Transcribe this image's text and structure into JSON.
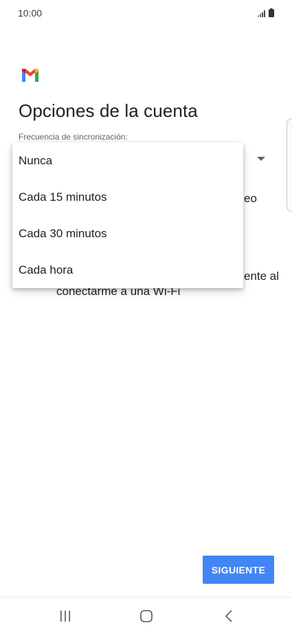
{
  "status_bar": {
    "time": "10:00",
    "icons": [
      "signal-icon",
      "battery-icon"
    ]
  },
  "app": {
    "logo": "gmail-logo",
    "title": "Opciones de la cuenta",
    "sync_label": "Frecuencia de sincronización:"
  },
  "dropdown": {
    "options": [
      "Nunca",
      "Cada 15 minutos",
      "Cada 30 minutos",
      "Cada hora"
    ]
  },
  "background_text": {
    "fragment_1": "eo",
    "fragment_2": "ente al",
    "fragment_3": "conectarme a una Wi-Fi"
  },
  "footer": {
    "next_label": "SIGUIENTE"
  },
  "nav_bar": {
    "icons": [
      "recent-apps-icon",
      "home-icon",
      "back-icon"
    ]
  },
  "colors": {
    "accent": "#4285f4",
    "text": "#202124",
    "secondary_text": "#5f6368"
  }
}
